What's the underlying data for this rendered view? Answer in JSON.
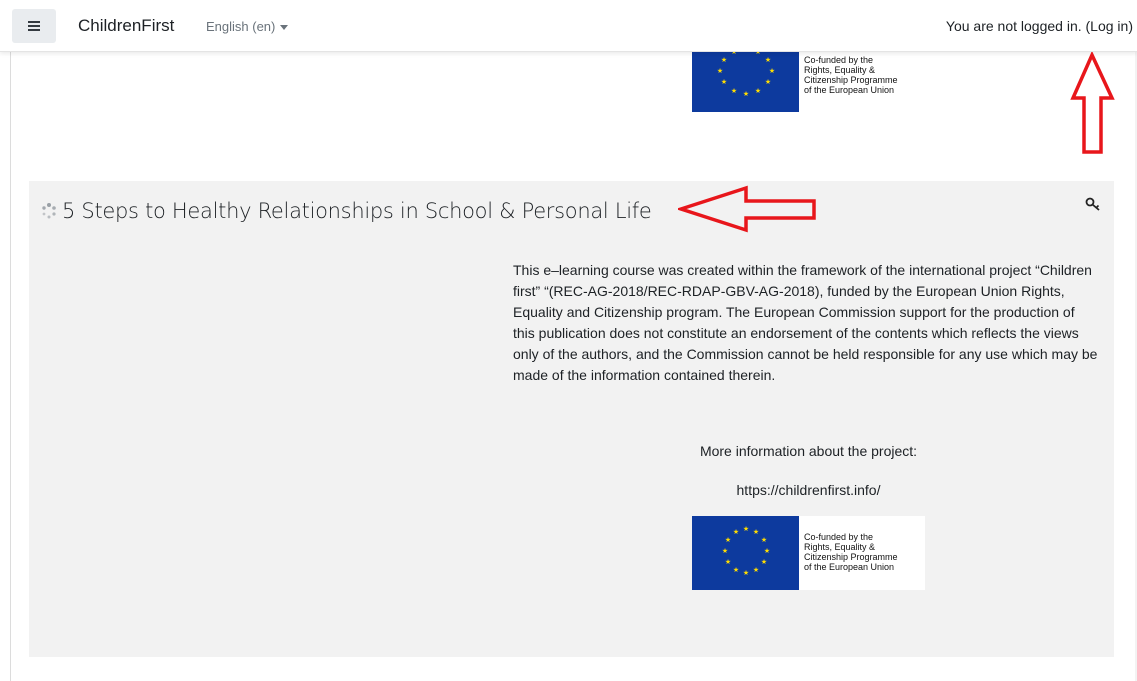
{
  "navbar": {
    "brand": "ChildrenFirst",
    "language": "English (en)",
    "login_prefix": "You are not logged in. (",
    "login_link": "Log in",
    "login_suffix": ")"
  },
  "eu_banner": {
    "lines": [
      "Co-funded by the",
      "Rights, Equality &",
      "Citizenship Programme",
      "of the European Union"
    ]
  },
  "section": {
    "title": "5 Steps to Healthy Relationships in School & Personal Life",
    "summary": "This e–learning course was created within the framework of the international project “Children first” “(REC-AG-2018/REC-RDAP-GBV-AG-2018), funded by the European Union Rights, Equality and Citizenship program. The European Commission support for the production of this publication does not constitute an endorsement of the contents which reflects the views only of the authors, and the Commission cannot be held responsible for any use which may be made of the information contained therein.",
    "more_info": "More information about the project:",
    "url": "https://childrenfirst.info/"
  },
  "colors": {
    "eu_blue": "#0d3a9e",
    "eu_star": "#ffdd00",
    "annotation_red": "#e8161b",
    "section_bg": "#f2f2f2"
  },
  "icons": {
    "menu": "hamburger-icon",
    "course": "course-loader-icon",
    "guest_access": "key-icon",
    "language": "chevron-down-icon"
  }
}
